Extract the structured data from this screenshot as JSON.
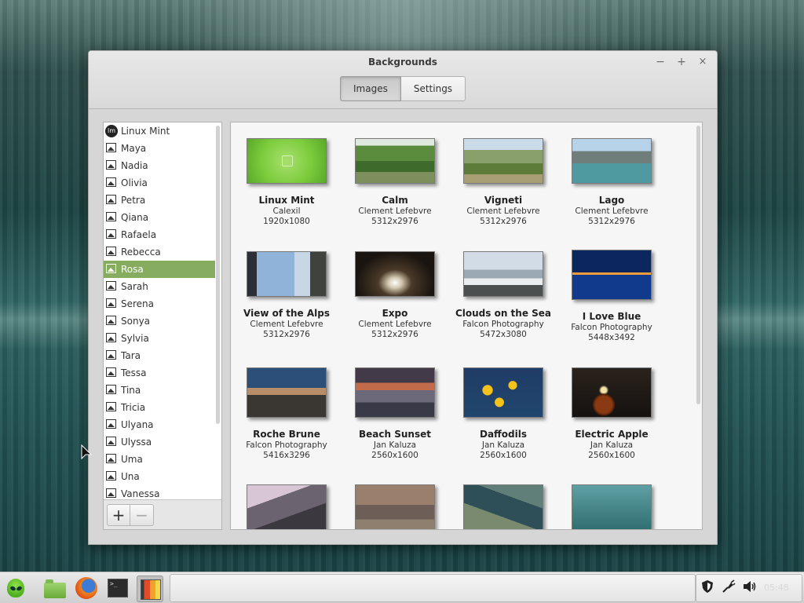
{
  "window": {
    "title": "Backgrounds",
    "controls": {
      "minimize": "−",
      "maximize": "+",
      "close": "×"
    },
    "tabs": [
      {
        "label": "Images",
        "active": true
      },
      {
        "label": "Settings",
        "active": false
      }
    ]
  },
  "sidebar": {
    "items": [
      {
        "label": "Linux Mint",
        "icon": "linux-mint-icon",
        "selected": false
      },
      {
        "label": "Maya",
        "icon": "image-icon",
        "selected": false
      },
      {
        "label": "Nadia",
        "icon": "image-icon",
        "selected": false
      },
      {
        "label": "Olivia",
        "icon": "image-icon",
        "selected": false
      },
      {
        "label": "Petra",
        "icon": "image-icon",
        "selected": false
      },
      {
        "label": "Qiana",
        "icon": "image-icon",
        "selected": false
      },
      {
        "label": "Rafaela",
        "icon": "image-icon",
        "selected": false
      },
      {
        "label": "Rebecca",
        "icon": "image-icon",
        "selected": false
      },
      {
        "label": "Rosa",
        "icon": "image-icon",
        "selected": true
      },
      {
        "label": "Sarah",
        "icon": "image-icon",
        "selected": false
      },
      {
        "label": "Serena",
        "icon": "image-icon",
        "selected": false
      },
      {
        "label": "Sonya",
        "icon": "image-icon",
        "selected": false
      },
      {
        "label": "Sylvia",
        "icon": "image-icon",
        "selected": false
      },
      {
        "label": "Tara",
        "icon": "image-icon",
        "selected": false
      },
      {
        "label": "Tessa",
        "icon": "image-icon",
        "selected": false
      },
      {
        "label": "Tina",
        "icon": "image-icon",
        "selected": false
      },
      {
        "label": "Tricia",
        "icon": "image-icon",
        "selected": false
      },
      {
        "label": "Ulyana",
        "icon": "image-icon",
        "selected": false
      },
      {
        "label": "Ulyssa",
        "icon": "image-icon",
        "selected": false
      },
      {
        "label": "Uma",
        "icon": "image-icon",
        "selected": false
      },
      {
        "label": "Una",
        "icon": "image-icon",
        "selected": false
      },
      {
        "label": "Vanessa",
        "icon": "image-icon",
        "selected": false
      }
    ],
    "add_label": "+",
    "remove_label": "−"
  },
  "backgrounds": [
    {
      "title": "Linux Mint",
      "author": "Calexil",
      "resolution": "1920x1080"
    },
    {
      "title": "Calm",
      "author": "Clement Lefebvre",
      "resolution": "5312x2976"
    },
    {
      "title": "Vigneti",
      "author": "Clement Lefebvre",
      "resolution": "5312x2976"
    },
    {
      "title": "Lago",
      "author": "Clement Lefebvre",
      "resolution": "5312x2976"
    },
    {
      "title": "View of the Alps",
      "author": "Clement Lefebvre",
      "resolution": "5312x2976"
    },
    {
      "title": "Expo",
      "author": "Clement Lefebvre",
      "resolution": "5312x2976"
    },
    {
      "title": "Clouds on the Sea",
      "author": "Falcon Photography",
      "resolution": "5472x3080"
    },
    {
      "title": "I Love Blue",
      "author": "Falcon Photography",
      "resolution": "5448x3492"
    },
    {
      "title": "Roche Brune",
      "author": "Falcon Photography",
      "resolution": "5416x3296"
    },
    {
      "title": "Beach Sunset",
      "author": "Jan Kaluza",
      "resolution": "2560x1600"
    },
    {
      "title": "Daffodils",
      "author": "Jan Kaluza",
      "resolution": "2560x1600"
    },
    {
      "title": "Electric Apple",
      "author": "Jan Kaluza",
      "resolution": "2560x1600"
    }
  ],
  "taskbar": {
    "menu_icon": "mint-alien-icon",
    "launchers": [
      "files-icon",
      "firefox-icon",
      "terminal-icon",
      "backgrounds-icon"
    ],
    "terminal_glyph": ">_",
    "tray_icons": [
      "shield-icon",
      "network-icon",
      "volume-icon"
    ],
    "clock": "05:48"
  },
  "colors": {
    "selection": "#86ad5f",
    "accent_mint": "#7ccc3c"
  }
}
